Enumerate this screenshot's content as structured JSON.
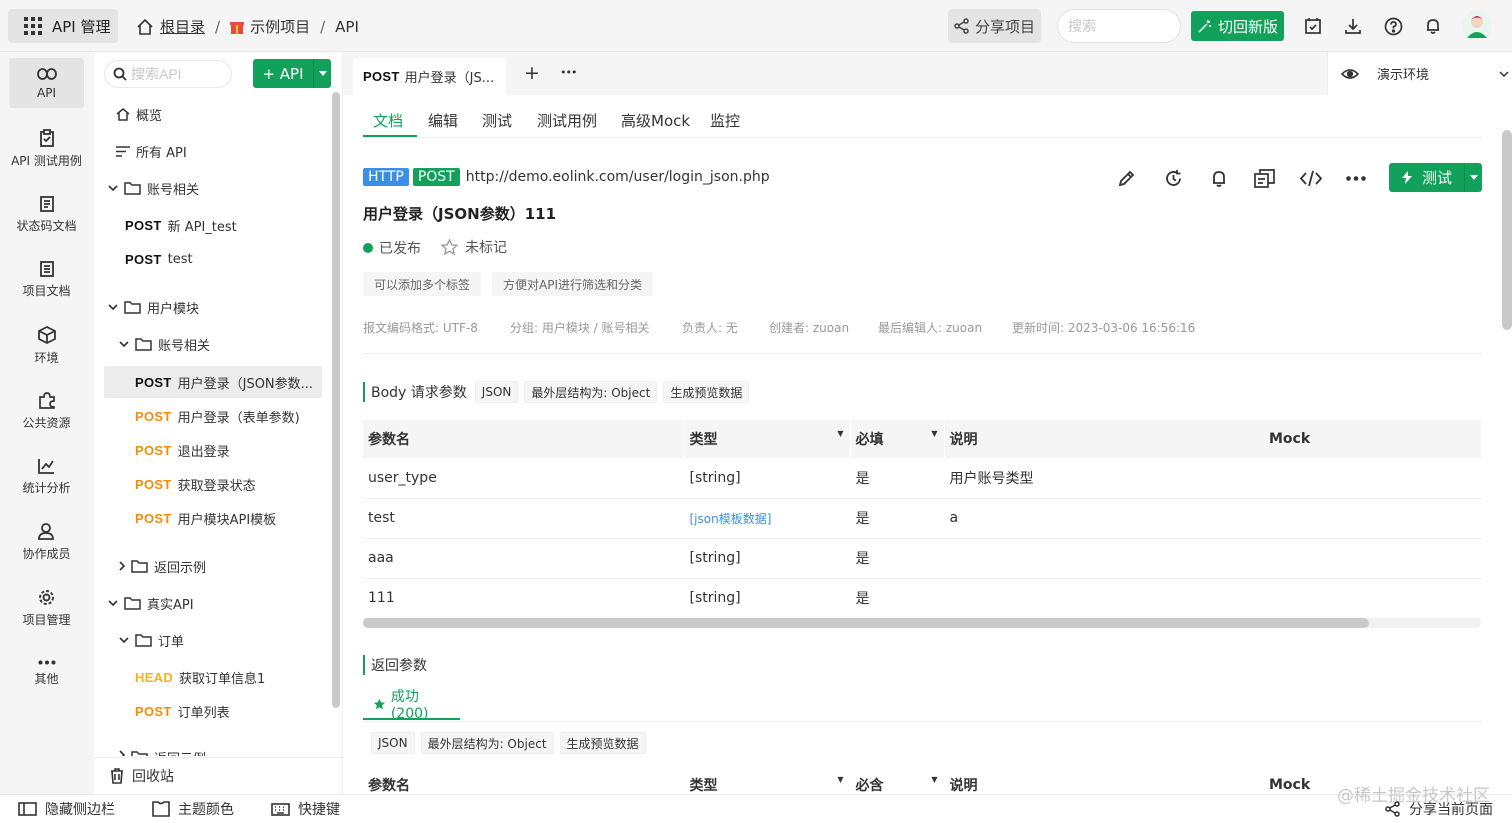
{
  "topbar": {
    "app_title": "API 管理",
    "breadcrumb": {
      "root": "根目录",
      "separator": "/",
      "project": "示例项目",
      "section": "API"
    },
    "share_label": "分享项目",
    "search_placeholder": "搜索",
    "new_version_label": "切回新版"
  },
  "nav": {
    "items": [
      {
        "label": "API",
        "icon": "link-icon"
      },
      {
        "label": "API 测试用例",
        "icon": "clipboard-icon"
      },
      {
        "label": "状态码文档",
        "icon": "document-icon"
      },
      {
        "label": "项目文档",
        "icon": "list-document-icon"
      },
      {
        "label": "环境",
        "icon": "cube-icon"
      },
      {
        "label": "公共资源",
        "icon": "puzzle-icon"
      },
      {
        "label": "统计分析",
        "icon": "chart-icon"
      },
      {
        "label": "协作成员",
        "icon": "users-icon"
      },
      {
        "label": "项目管理",
        "icon": "gear-icon"
      },
      {
        "label": "其他",
        "icon": "more-icon"
      }
    ]
  },
  "tree": {
    "search_placeholder": "搜索API",
    "add_label": "+ API",
    "overview": "概览",
    "all_api": "所有 API",
    "folder_account": "账号相关",
    "a1_method": "POST",
    "a1_label": "新 API_test",
    "a2_method": "POST",
    "a2_label": "test",
    "folder_user": "用户模块",
    "folder_user_account": "账号相关",
    "b1_method": "POST",
    "b1_label": "用户登录（JSON参数...",
    "b2_method": "POST",
    "b2_label": "用户登录（表单参数)",
    "b3_method": "POST",
    "b3_label": "退出登录",
    "b4_method": "POST",
    "b4_label": "获取登录状态",
    "b5_method": "POST",
    "b5_label": "用户模块API模板",
    "folder_return": "返回示例",
    "folder_real": "真实API",
    "folder_order": "订单",
    "c1_method": "HEAD",
    "c1_label": "获取订单信息1",
    "c2_method": "POST",
    "c2_label": "订单列表",
    "folder_return2": "返回示例",
    "recycle": "回收站"
  },
  "tabs": {
    "tab1_method": "POST",
    "tab1_title": "用户登录（JS...",
    "add": "+",
    "more": "•••",
    "env": "演示环境"
  },
  "subtabs": [
    "文档",
    "编辑",
    "测试",
    "测试用例",
    "高级Mock",
    "监控"
  ],
  "api": {
    "protocol": "HTTP",
    "method": "POST",
    "url": "http://demo.eolink.com/user/login_json.php",
    "title": "用户登录（JSON参数）111",
    "status": "已发布",
    "star": "未标记",
    "tag1": "可以添加多个标签",
    "tag2": "方便对API进行筛选和分类",
    "test_label": "测试",
    "meta": {
      "encoding": "报文编码格式: UTF-8",
      "group": "分组: 用户模块 / 账号相关",
      "owner": "负责人: 无",
      "creator": "创建者: zuoan",
      "editor": "最后编辑人: zuoan",
      "updated": "更新时间: 2023-03-06 16:56:16"
    }
  },
  "body": {
    "title": "Body 请求参数",
    "format": "JSON",
    "outer": "最外层结构为: Object",
    "preview": "生成预览数据",
    "headers": {
      "name": "参数名",
      "type": "类型",
      "required": "必填",
      "desc": "说明",
      "mock": "Mock"
    },
    "rows": [
      {
        "name": "user_type",
        "type": "[string]",
        "required": "是",
        "desc": "用户账号类型"
      },
      {
        "name": "test",
        "type": "[json模板数据]",
        "required": "是",
        "desc": "a"
      },
      {
        "name": "aaa",
        "type": "[string]",
        "required": "是",
        "desc": ""
      },
      {
        "name": "111",
        "type": "[string]",
        "required": "是",
        "desc": ""
      }
    ]
  },
  "response": {
    "title": "返回参数",
    "tab": "成功 (200)",
    "format": "JSON",
    "outer": "最外层结构为: Object",
    "preview": "生成预览数据",
    "headers": {
      "name": "参数名",
      "type": "类型",
      "required": "必含",
      "desc": "说明",
      "mock": "Mock"
    }
  },
  "footer": {
    "hide_sidebar": "隐藏侧边栏",
    "theme": "主题颜色",
    "shortcut": "快捷键",
    "share_page": "分享当前页面",
    "watermark": "@稀土掘金技术社区"
  },
  "colors": {
    "brand": "#12a15a",
    "http": "#3a8ee6",
    "post": "#12a15a",
    "head": "#f3b41b"
  }
}
